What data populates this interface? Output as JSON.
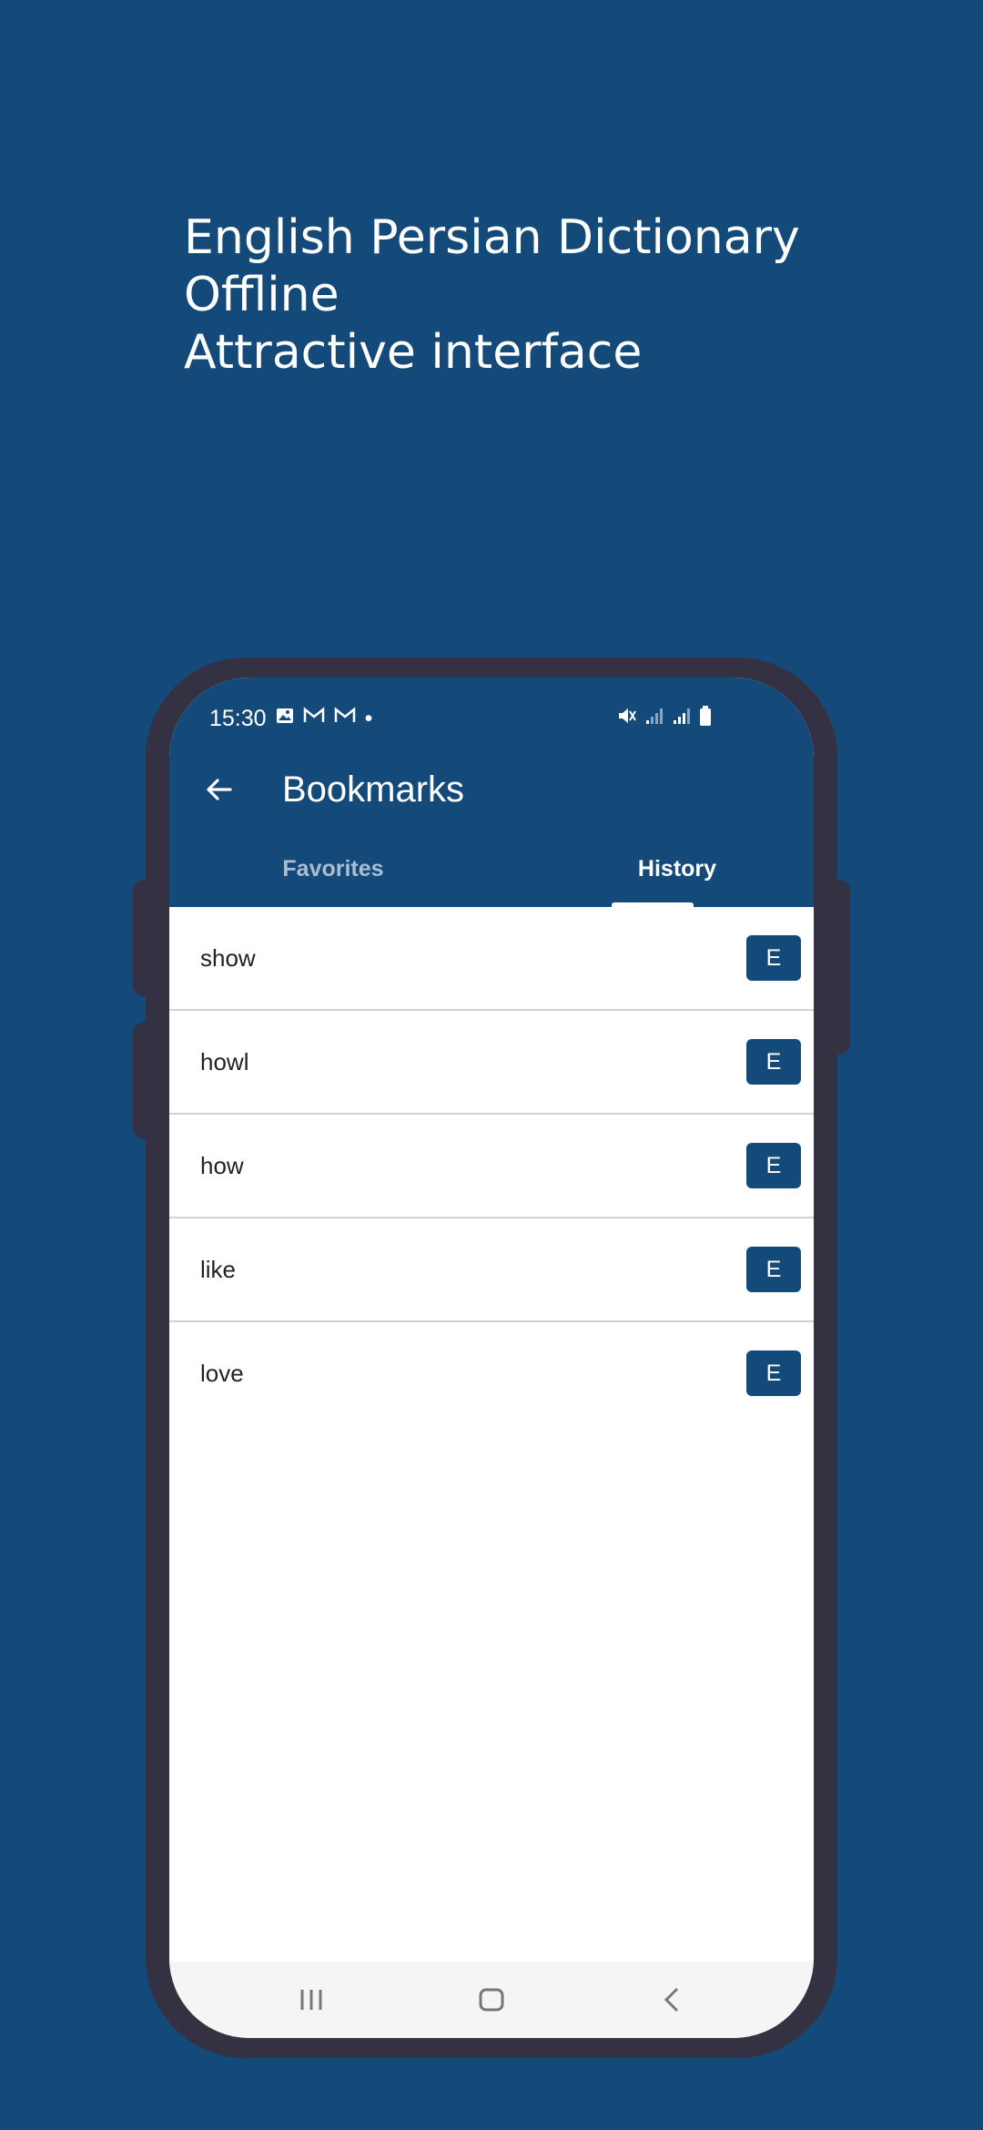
{
  "promo": {
    "line1": "English Persian Dictionary",
    "line2": "Offline",
    "line3": "Attractive interface"
  },
  "status_bar": {
    "time": "15:30",
    "dot": "•"
  },
  "app_bar": {
    "title": "Bookmarks"
  },
  "tabs": [
    {
      "label": "Favorites",
      "selected": false
    },
    {
      "label": "History",
      "selected": true
    }
  ],
  "history": [
    {
      "word": "show",
      "button": "E"
    },
    {
      "word": "howl",
      "button": "E"
    },
    {
      "word": "how",
      "button": "E"
    },
    {
      "word": "like",
      "button": "E"
    },
    {
      "word": "love",
      "button": "E"
    }
  ],
  "colors": {
    "primary": "#144a7a",
    "phone_frame": "#343142",
    "tab_inactive": "#a9bdd3",
    "divider": "#d2d2d2"
  },
  "icons": {
    "back": "arrow-left-icon",
    "nav_recents": "recents-icon",
    "nav_home": "home-icon",
    "nav_back": "chevron-left-icon"
  }
}
